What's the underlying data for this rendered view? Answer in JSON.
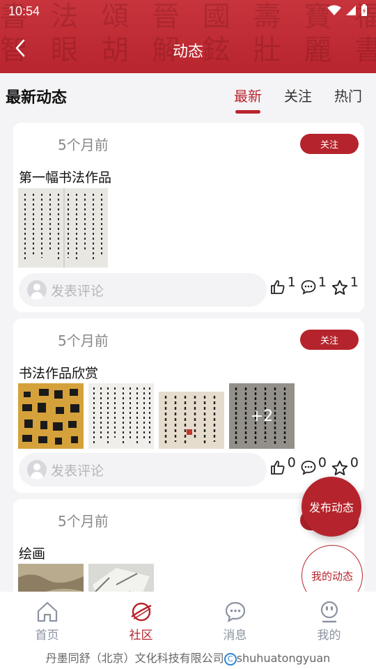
{
  "status": {
    "time": "10:54"
  },
  "header": {
    "title": "动态"
  },
  "feed": {
    "section_title": "最新动态",
    "tabs": [
      {
        "label": "最新",
        "active": true
      },
      {
        "label": "关注",
        "active": false
      },
      {
        "label": "热门",
        "active": false
      }
    ]
  },
  "posts": [
    {
      "time": "5个月前",
      "follow_label": "关注",
      "text": "第一幅书法作品",
      "image_count": 1,
      "comment_placeholder": "发表评论",
      "likes": "1",
      "comments": "1",
      "favorites": "1"
    },
    {
      "time": "5个月前",
      "follow_label": "关注",
      "text": "书法作品欣赏",
      "image_count": 4,
      "more_label": "+2",
      "comment_placeholder": "发表评论",
      "likes": "0",
      "comments": "0",
      "favorites": "0"
    },
    {
      "time": "5个月前",
      "follow_label": "关注",
      "text": "绘画",
      "image_count": 2
    }
  ],
  "fab": {
    "publish": "发布动态",
    "mine": "我的动态"
  },
  "nav": [
    {
      "label": "首页",
      "icon": "home-icon",
      "active": false
    },
    {
      "label": "社区",
      "icon": "planet-icon",
      "active": true
    },
    {
      "label": "消息",
      "icon": "chat-icon",
      "active": false
    },
    {
      "label": "我的",
      "icon": "profile-icon",
      "active": false
    }
  ],
  "footer": {
    "company": "丹墨同舒（北京）文化科技有限公司",
    "copyright_mark": "C",
    "domain": "shuhuatongyuan"
  },
  "colors": {
    "brand": "#b5242c",
    "header": "#c8343c",
    "inactive": "#8a93a0"
  }
}
